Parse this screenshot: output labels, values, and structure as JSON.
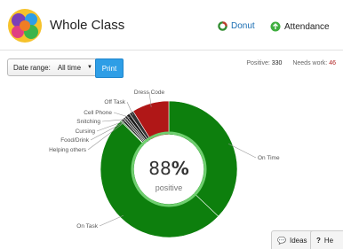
{
  "header": {
    "title": "Whole Class",
    "donut_label": "Donut",
    "attendance_label": "Attendance",
    "accent_green": "#2f8b2f",
    "accent_red": "#c0392b"
  },
  "toolbar": {
    "date_range_label": "Date range:",
    "date_range_value": "All time",
    "print_label": "Print"
  },
  "stats": {
    "positive_label": "Positive:",
    "positive_value": "330",
    "needs_work_label": "Needs work:",
    "needs_work_value": "46"
  },
  "chart_data": {
    "type": "pie",
    "center_value": "88",
    "center_percent": "%",
    "center_label": "positive",
    "slices": [
      {
        "label": "On Time",
        "value": 140,
        "color": "#0d7f0d"
      },
      {
        "label": "On Task",
        "value": 190,
        "color": "#0d7f0d"
      },
      {
        "label": "Helping others",
        "value": 1,
        "color": "#0d7f0d"
      },
      {
        "label": "Food/Drink",
        "value": 2,
        "color": "#222222"
      },
      {
        "label": "Cursing",
        "value": 2,
        "color": "#444444"
      },
      {
        "label": "Snitching",
        "value": 2,
        "color": "#2a2a2a"
      },
      {
        "label": "Cell Phone",
        "value": 3,
        "color": "#1a1a1a"
      },
      {
        "label": "Off Task",
        "value": 4,
        "color": "#333333"
      },
      {
        "label": "Dress Code",
        "value": 33,
        "color": "#b01717"
      }
    ]
  },
  "footer": {
    "ideas_label": "Ideas",
    "help_label": "He"
  }
}
